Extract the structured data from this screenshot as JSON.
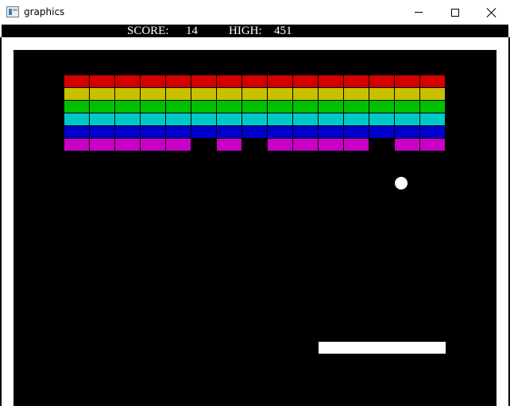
{
  "window": {
    "title": "graphics",
    "icon": "app-window-icon",
    "controls": [
      "minimize-icon",
      "maximize-icon",
      "close-icon"
    ]
  },
  "hud": {
    "score_label": "SCORE:",
    "score_value": "14",
    "high_label": "HIGH:",
    "high_value": "451"
  },
  "game": {
    "columns": 15,
    "rows": [
      {
        "color": "#d40000",
        "bricks": [
          1,
          1,
          1,
          1,
          1,
          1,
          1,
          1,
          1,
          1,
          1,
          1,
          1,
          1,
          1
        ]
      },
      {
        "color": "#c8c000",
        "bricks": [
          1,
          1,
          1,
          1,
          1,
          1,
          1,
          1,
          1,
          1,
          1,
          1,
          1,
          1,
          1
        ]
      },
      {
        "color": "#00c000",
        "bricks": [
          1,
          1,
          1,
          1,
          1,
          1,
          1,
          1,
          1,
          1,
          1,
          1,
          1,
          1,
          1
        ]
      },
      {
        "color": "#00c8c8",
        "bricks": [
          1,
          1,
          1,
          1,
          1,
          1,
          1,
          1,
          1,
          1,
          1,
          1,
          1,
          1,
          1
        ]
      },
      {
        "color": "#0000cc",
        "bricks": [
          1,
          1,
          1,
          1,
          1,
          1,
          1,
          1,
          1,
          1,
          1,
          1,
          1,
          1,
          1
        ]
      },
      {
        "color": "#c800c8",
        "bricks": [
          1,
          1,
          1,
          1,
          1,
          0,
          1,
          0,
          1,
          1,
          1,
          1,
          0,
          1,
          1
        ]
      }
    ],
    "bricks_remaining": 87
  }
}
